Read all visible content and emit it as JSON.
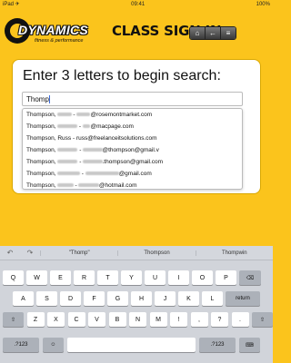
{
  "status": {
    "left": "iPad ✈",
    "time": "09:41",
    "right": "100%"
  },
  "logo": {
    "name": "DYNAMICS",
    "tagline": "fitness & performance"
  },
  "header": {
    "title": "CLASS SIGN IN",
    "home_icon": "home-icon",
    "back_icon": "back-arrow-icon",
    "menu_icon": "menu-icon"
  },
  "search": {
    "prompt": "Enter 3 letters to begin search:",
    "value": "Thomp",
    "results": [
      {
        "last": "Thompson,",
        "first": "Molly",
        "email_prefix": "Molly",
        "email_domain": "@rosemontmarket.com"
      },
      {
        "last": "Thompson,",
        "first": "Kristina",
        "email_prefix": "km",
        "email_domain": "@macpage.com"
      },
      {
        "last": "Thompson,",
        "first": "Russ",
        "email_prefix": "russ",
        "email_domain": "@freelanceitsolutions.com"
      },
      {
        "last": "Thompson,",
        "first": "Pamela",
        "email_prefix": "pamela",
        "email_domain": "@thompson@gmail.v"
      },
      {
        "last": "Thompson,",
        "first": "Pamela",
        "email_prefix": "pamela",
        "email_domain": ".thompson@gmail.com"
      },
      {
        "last": "Thompson,",
        "first": "Matthew",
        "email_prefix": "mattyhmaley",
        "email_domain": "@gmail.com"
      },
      {
        "last": "Thompson,",
        "first": "Jamie",
        "email_prefix": "jt_jamie",
        "email_domain": "@hotmail.com"
      }
    ]
  },
  "keyboard": {
    "suggestions": [
      "\"Thomp\"",
      "Thompson",
      "Thompwin"
    ],
    "row1": [
      "Q",
      "W",
      "E",
      "R",
      "T",
      "Y",
      "U",
      "I",
      "O",
      "P",
      "⌫"
    ],
    "row2": [
      "A",
      "S",
      "D",
      "F",
      "G",
      "H",
      "J",
      "K",
      "L",
      "return"
    ],
    "row3": [
      "⇧",
      "Z",
      "X",
      "C",
      "V",
      "B",
      "N",
      "M",
      "!",
      ",",
      "?",
      ".",
      "⇧"
    ],
    "row4": [
      ".?123",
      "☺",
      "",
      ".?123",
      "⌨"
    ]
  }
}
